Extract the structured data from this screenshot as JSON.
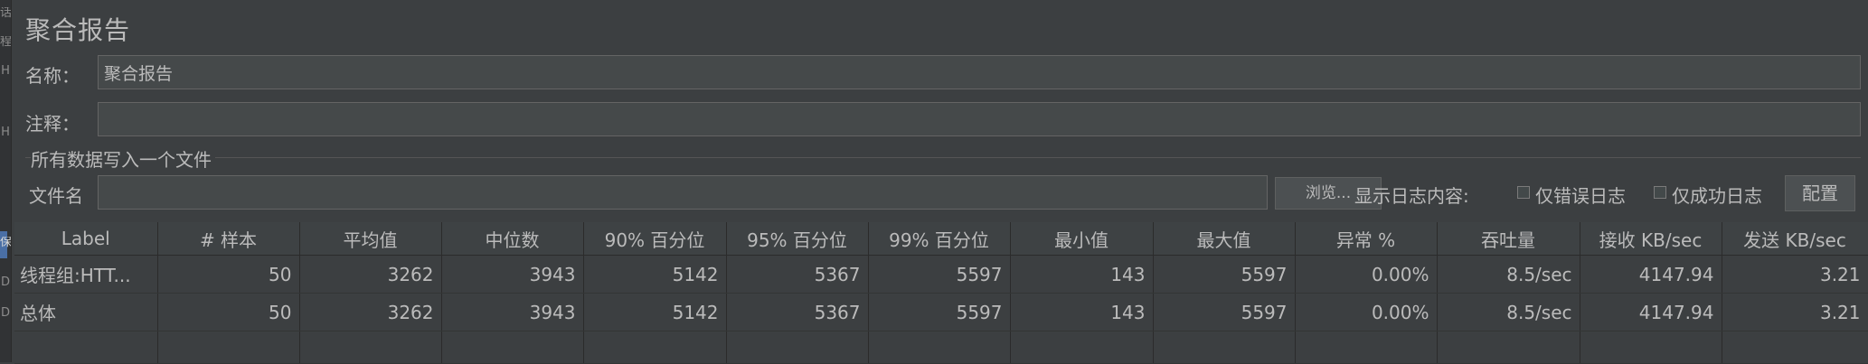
{
  "left_strip": {
    "glyphs": [
      "话",
      "程",
      "H",
      "H",
      "保",
      "D",
      "D"
    ]
  },
  "panel": {
    "title": "聚合报告",
    "name_label": "名称：",
    "name_value": "聚合报告",
    "comment_label": "注释：",
    "comment_value": ""
  },
  "file_section": {
    "legend": "所有数据写入一个文件",
    "file_label": "文件名",
    "file_value": "",
    "browse_label": "浏览...",
    "log_content_label": "显示日志内容:",
    "errors_only_label": "仅错误日志",
    "success_only_label": "仅成功日志",
    "config_label": "配置"
  },
  "table": {
    "columns": [
      "Label",
      "# 样本",
      "平均值",
      "中位数",
      "90% 百分位",
      "95% 百分位",
      "99% 百分位",
      "最小值",
      "最大值",
      "异常 %",
      "吞吐量",
      "接收 KB/sec",
      "发送 KB/sec"
    ],
    "rows": [
      [
        "线程组:HTT...",
        "50",
        "3262",
        "3943",
        "5142",
        "5367",
        "5597",
        "143",
        "5597",
        "0.00%",
        "8.5/sec",
        "4147.94",
        "3.21"
      ],
      [
        "总体",
        "50",
        "3262",
        "3943",
        "5142",
        "5367",
        "5597",
        "143",
        "5597",
        "0.00%",
        "8.5/sec",
        "4147.94",
        "3.21"
      ]
    ]
  }
}
